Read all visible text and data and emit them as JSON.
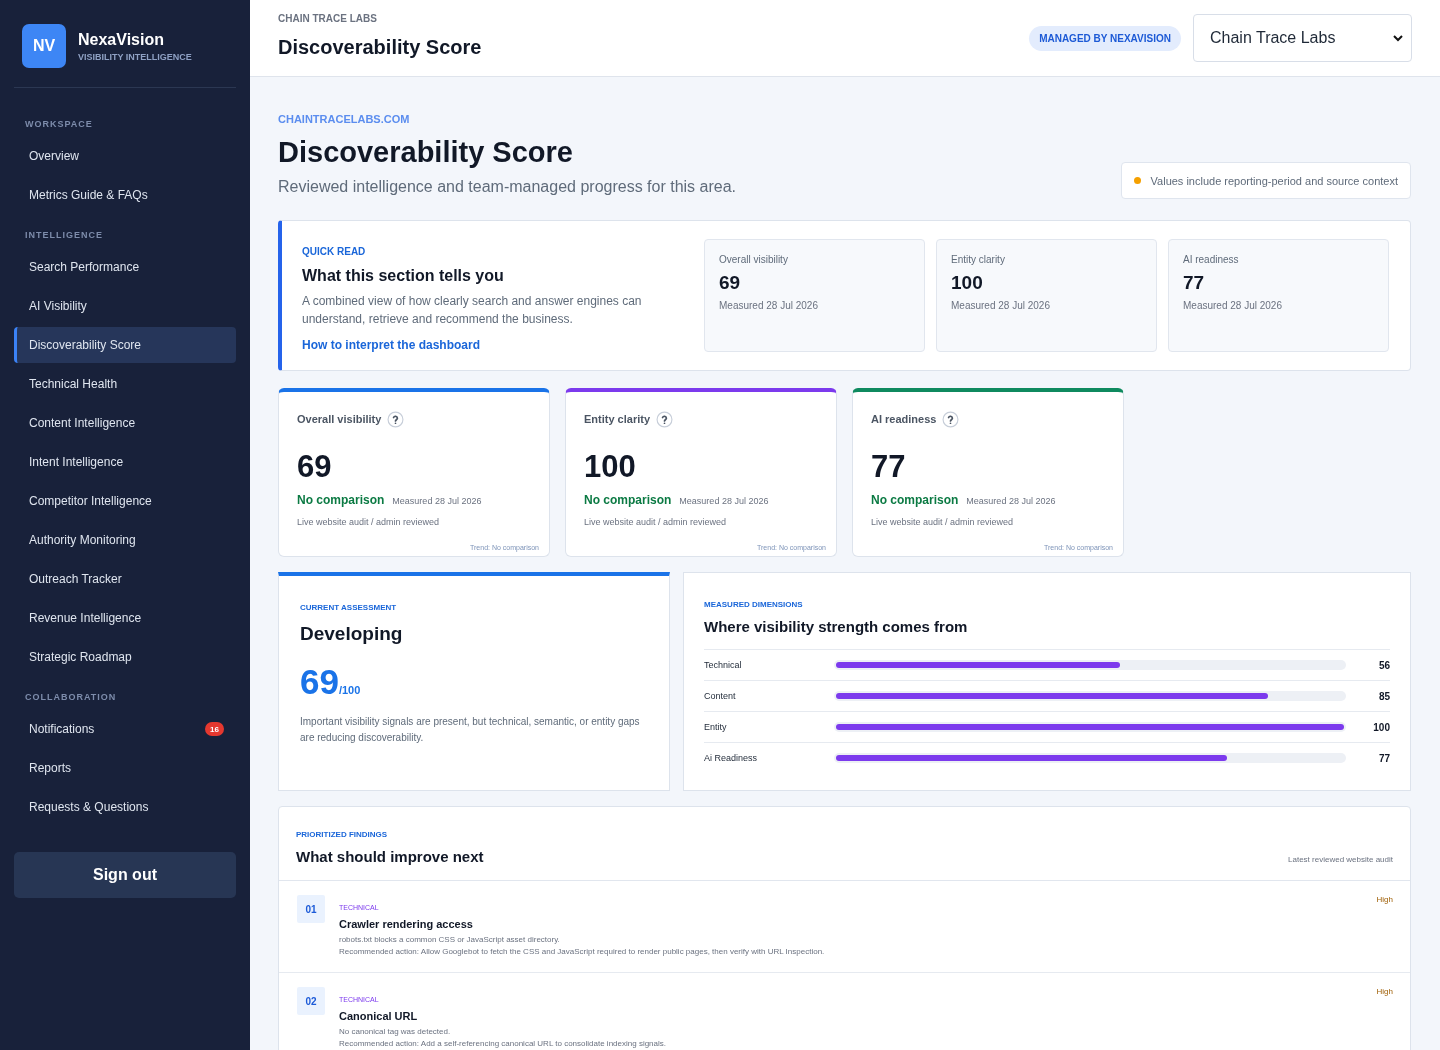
{
  "sidebar": {
    "brand": {
      "logo": "NV",
      "name": "NexaVision",
      "tagline": "VISIBILITY INTELLIGENCE"
    },
    "sections": [
      {
        "label": "WORKSPACE",
        "items": [
          {
            "label": "Overview",
            "selected": false
          },
          {
            "label": "Metrics Guide & FAQs",
            "selected": false
          }
        ]
      },
      {
        "label": "INTELLIGENCE",
        "items": [
          {
            "label": "Search Performance",
            "selected": false
          },
          {
            "label": "AI Visibility",
            "selected": false
          },
          {
            "label": "Discoverability Score",
            "selected": true
          },
          {
            "label": "Technical Health",
            "selected": false
          },
          {
            "label": "Content Intelligence",
            "selected": false
          },
          {
            "label": "Intent Intelligence",
            "selected": false
          },
          {
            "label": "Competitor Intelligence",
            "selected": false
          },
          {
            "label": "Authority Monitoring",
            "selected": false
          },
          {
            "label": "Outreach Tracker",
            "selected": false
          },
          {
            "label": "Revenue Intelligence",
            "selected": false
          },
          {
            "label": "Strategic Roadmap",
            "selected": false
          }
        ]
      },
      {
        "label": "COLLABORATION",
        "items": [
          {
            "label": "Notifications",
            "selected": false,
            "badge": "16"
          },
          {
            "label": "Reports",
            "selected": false
          },
          {
            "label": "Requests & Questions",
            "selected": false
          }
        ]
      }
    ],
    "sign_out": "Sign out"
  },
  "header": {
    "eyebrow": "CHAIN TRACE LABS",
    "title": "Discoverability Score",
    "badge": "MANAGED BY NEXAVISION",
    "client_select": {
      "value": "Chain Trace Labs"
    }
  },
  "hero": {
    "domain": "CHAINTRACELABS.COM",
    "title": "Discoverability Score",
    "subtitle": "Reviewed intelligence and team-managed progress for this area.",
    "notice": "Values include reporting-period and source context"
  },
  "quick_read": {
    "label": "QUICK READ",
    "title": "What this section tells you",
    "text": "A combined view of how clearly search and answer engines can understand, retrieve and recommend the business.",
    "link": "How to interpret the dashboard",
    "stats": [
      {
        "label": "Overall visibility",
        "value": "69",
        "measured": "Measured 28 Jul 2026"
      },
      {
        "label": "Entity clarity",
        "value": "100",
        "measured": "Measured 28 Jul 2026"
      },
      {
        "label": "AI readiness",
        "value": "77",
        "measured": "Measured 28 Jul 2026"
      }
    ]
  },
  "kpi_cards": [
    {
      "label": "Overall visibility",
      "color": "#1a73e8",
      "value": "69",
      "comparison": "No comparison",
      "measured": "Measured 28 Jul 2026",
      "source": "Live website audit / admin reviewed",
      "trend": "Trend: No comparison"
    },
    {
      "label": "Entity clarity",
      "color": "#7c3aed",
      "value": "100",
      "comparison": "No comparison",
      "measured": "Measured 28 Jul 2026",
      "source": "Live website audit / admin reviewed",
      "trend": "Trend: No comparison"
    },
    {
      "label": "AI readiness",
      "color": "#0f8a5f",
      "value": "77",
      "comparison": "No comparison",
      "measured": "Measured 28 Jul 2026",
      "source": "Live website audit / admin reviewed",
      "trend": "Trend: No comparison"
    }
  ],
  "assessment": {
    "label": "CURRENT ASSESSMENT",
    "status": "Developing",
    "score": "69",
    "scale": "/100",
    "text": "Important visibility signals are present, but technical, semantic, or entity gaps are reducing discoverability."
  },
  "dimensions": {
    "label": "MEASURED DIMENSIONS",
    "title": "Where visibility strength comes from",
    "rows": [
      {
        "name": "Technical",
        "level": 0.56,
        "value": "56"
      },
      {
        "name": "Content",
        "level": 0.85,
        "value": "85"
      },
      {
        "name": "Entity",
        "level": 1.0,
        "value": "100"
      },
      {
        "name": "Ai Readiness",
        "level": 0.77,
        "value": "77"
      }
    ]
  },
  "findings": {
    "label": "PRIORITIZED FINDINGS",
    "title": "What should improve next",
    "source": "Latest reviewed website audit",
    "items": [
      {
        "number": "01",
        "category": "TECHNICAL",
        "title": "Crawler rendering access",
        "description": "robots.txt blocks a common CSS or JavaScript asset directory.",
        "recommendation": "Recommended action: Allow Googlebot to fetch the CSS and JavaScript required to render public pages, then verify with URL Inspection.",
        "priority": "High"
      },
      {
        "number": "02",
        "category": "TECHNICAL",
        "title": "Canonical URL",
        "description": "No canonical tag was detected.",
        "recommendation": "Recommended action: Add a self-referencing canonical URL to consolidate indexing signals.",
        "priority": "High"
      }
    ]
  }
}
